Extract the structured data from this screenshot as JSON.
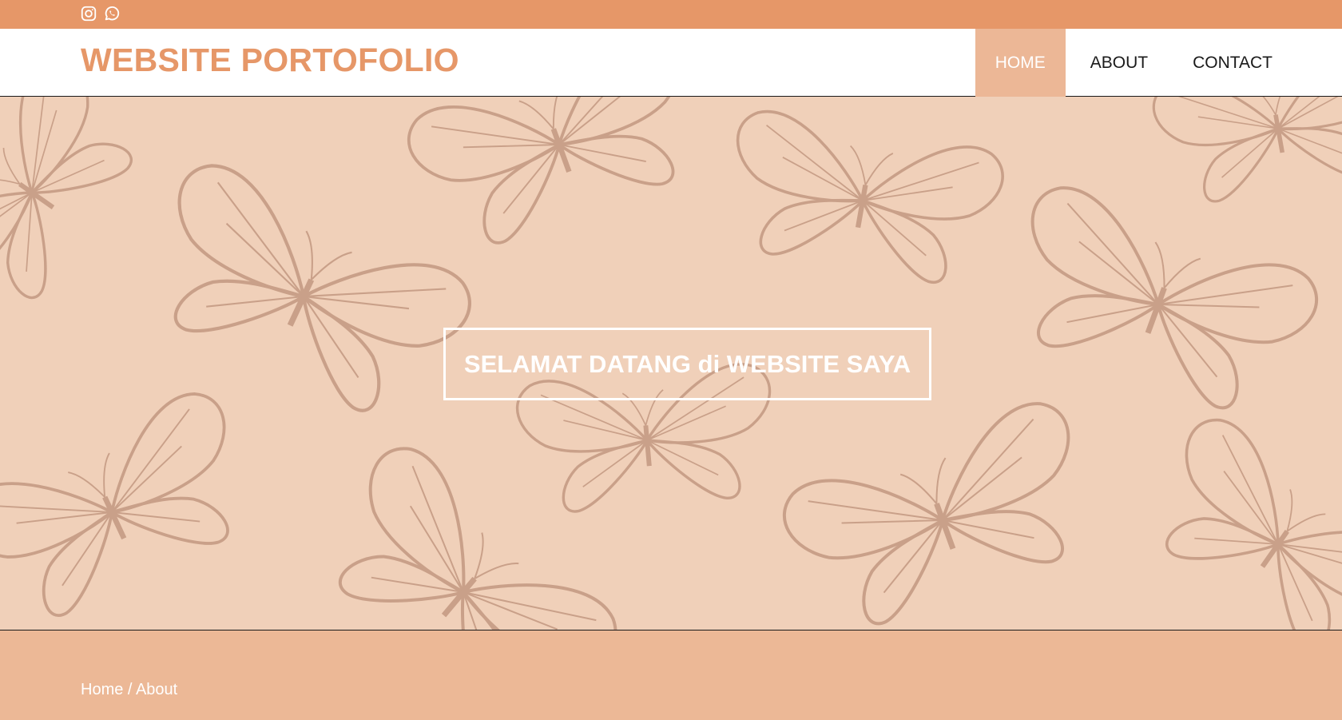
{
  "topbar": {
    "color": "#e69768",
    "icons": [
      "instagram-icon",
      "whatsapp-icon"
    ]
  },
  "brand": {
    "title": "WEBSITE PORTOFOLIO",
    "color": "#e69768"
  },
  "nav": {
    "items": [
      {
        "label": "HOME",
        "active": true
      },
      {
        "label": "ABOUT",
        "active": false
      },
      {
        "label": "CONTACT",
        "active": false
      }
    ],
    "active_color": "#ecb796"
  },
  "hero": {
    "title": "SELAMAT DATANG di WEBSITE SAYA",
    "background_color": "#f0d0b9",
    "pattern": "butterfly-pattern"
  },
  "breadcrumb": {
    "home": "Home",
    "separator": " / ",
    "current": "About",
    "background_color": "#ecb896"
  }
}
